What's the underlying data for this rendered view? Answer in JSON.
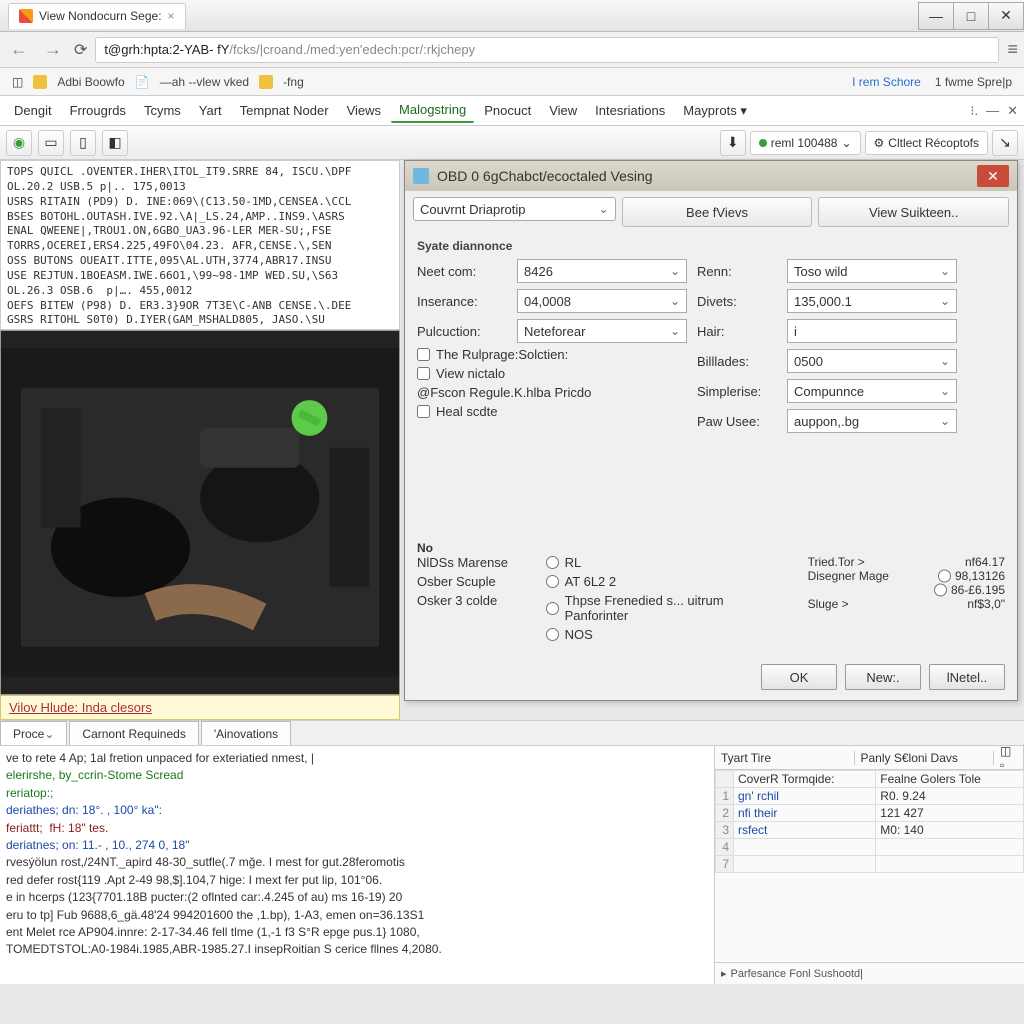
{
  "window": {
    "tab_title": "View Nondocurn Sege:",
    "url_primary": "t@grh:hpta:2-YAB- fY",
    "url_secondary": " /fcks/|croand./med:yen'edech:pcr/:rkjchepy"
  },
  "bookmarks": {
    "items": [
      "Adbi Boowfo",
      "—ah --vlew vked",
      "-fng"
    ],
    "right": [
      "I rem Schore",
      "1 fwme Spre|p"
    ]
  },
  "menubar": {
    "items": [
      "Dengit",
      "Frrougrds",
      "Tcyms",
      "Yart",
      "Tempnat Noder",
      "Views",
      "Malogstring",
      "Pnocuct",
      "View",
      "Intesriations",
      "Mayprots ▾"
    ],
    "active_index": 6
  },
  "toolbar2": {
    "right_tags": [
      "reml 100488",
      "Cltlect Récoptofs"
    ]
  },
  "leftcode": "TOPS QUICL .OVENTER.IHER\\ITOL_IT9.SRRE 84, ISCU.\\DPF\nOL.20.2 USB.5 p|.. 175,0013\nUSRS RITAIN (PD9) D. INE:069\\(C13.50-1MD,CENSEA.\\CCL\nBSES BOTOHL.OUTASH.IVE.92.\\A|_LS.24,AMP..INS9.\\ASRS\nENAL QWEENE|,TROU1.ON,6GBO_UA3.96-LER MER-SU;,FSE\nTORRS,OCEREI,ERS4.225,49FO\\04.23. AFR,CENSE.\\,SEN\nOSS BUTONS OUEAIT.ITTE,095\\AL.UTH,3774,ABR17.INSU\nUSE REJTUN.1BOEASM.IWE.66O1,\\99~98-1MP WED.SU,\\S63\nOL.26.3 OSB.6  p|…. 455,0012\nOEFS BITEW (P98) D. ER3.3}9OR 7T3E\\C-ANB CENSE.\\.DEE\nGSRS RITOHL S0T0) D.IYER(GAM_MSHALD805, JASO.\\SU",
  "caption": "Vilov Hlude: Inda clesors",
  "dialog": {
    "title": "OBD 0 6gChabct/ecoctaled Vesing",
    "tabs": [
      "Couvrnt Driaprotip",
      "Bee fVievs",
      "View Suikteen.."
    ],
    "section": "Syate diannonce",
    "fields": {
      "neet_com_label": "Neet com:",
      "neet_com": "8426",
      "renn_label": "Renn:",
      "renn": "Toso wild",
      "inserance_label": "Inserance:",
      "inserance": "04,0008",
      "divets_label": "Divets:",
      "divets": "135,000.1",
      "pulcuction_label": "Pulcuction:",
      "pulcuction": "Neteforear",
      "hair_label": "Hair:",
      "hair": "i",
      "billades_label": "Billlades:",
      "billades": "0500",
      "simplerise_label": "Simplerise:",
      "simplerise": "Compunnce",
      "paw_usee_label": "Paw Usee:",
      "paw_usee": "auppon,.bg"
    },
    "checks": [
      "The Rulprage:Solctien:",
      "View nictalo",
      "@Fscon Regule.K.hlba Pricdo",
      "Heal scdte"
    ],
    "no_label": "No",
    "radio_left_labels": [
      "NlDSs Marense",
      "Osber Scuple",
      "Osker 3 colde",
      ""
    ],
    "radio_left_opts": [
      "RL",
      "AT 6L2 2",
      "Thpse Frenedied s... uitrum Panforinter",
      "NOS"
    ],
    "stats_labels": [
      "Tried.Tor >",
      "Disegner Mage",
      "",
      "Sluge >"
    ],
    "stats_vals": [
      "nf64.17",
      "98,13126",
      "86-£6.195",
      "nf$3,0\""
    ],
    "buttons": [
      "OK",
      "New:.",
      "lNetel.."
    ]
  },
  "bottom_tabs": [
    "Proce",
    "Carnont Requineds",
    "'Ainovations"
  ],
  "console_lines": [
    {
      "c": "",
      "t": "ve to rete 4 Ap; 1al fretion unpaced for exteriatied nmest, |"
    },
    {
      "c": "g",
      "t": "elerirshe, by_ccrin-Stome Scread"
    },
    {
      "c": "g",
      "t": "reriatop:;"
    },
    {
      "c": "b",
      "t": "deriathes; dn: 18°. , 100° ka\":"
    },
    {
      "c": "r",
      "t": "feriattt;  fH: 18\" tes."
    },
    {
      "c": "b",
      "t": "deriatnes; on: 11.- , 10., 274 0, 18\""
    },
    {
      "c": "",
      "t": ""
    },
    {
      "c": "",
      "t": "rvesýölun rost,/24NT._apird 48-30_sutfle(.7 mğe. I mest for gut.28feromotis"
    },
    {
      "c": "",
      "t": "red defer rost{119 .Apt 2-49 98,$].104,7 hige: I mext fer put lip, 101°06."
    },
    {
      "c": "",
      "t": "e in hcerps (123{7701.18B pucter:(2 oflnted car:.4.245 of au) ms 16-19) 20"
    },
    {
      "c": "",
      "t": "eru to tp] Fub 9688,6_gä.48'24 994201600 the ,1.bp), 1-A3, emen on=36.13S1"
    },
    {
      "c": "",
      "t": "ent Melet rce AP904.innre: 2-17-34.46 fell tlme (1,-1 f3 S°R epge pus.1} 1080,"
    },
    {
      "c": "",
      "t": "TOMEDTSTOL:A0-1984i.1985,ABR-1985.27.I insepRoitian S cerice fllnes 4,2080."
    }
  ],
  "sidepanel": {
    "cols": [
      "Tyart Tire",
      "Panly S€loni Davs"
    ],
    "head2": [
      "CoverR Tormqide:",
      "Fealne Golers Tole"
    ],
    "rows": [
      [
        "1",
        "gn' rchil",
        "R0. 9.24"
      ],
      [
        "2",
        "nfi their",
        "121 427"
      ],
      [
        "3",
        "rsfect",
        "M0: 140"
      ],
      [
        "4",
        "",
        ""
      ],
      [
        "7",
        "",
        ""
      ]
    ],
    "footer": "Parfesance Fonl Sushootd|"
  }
}
